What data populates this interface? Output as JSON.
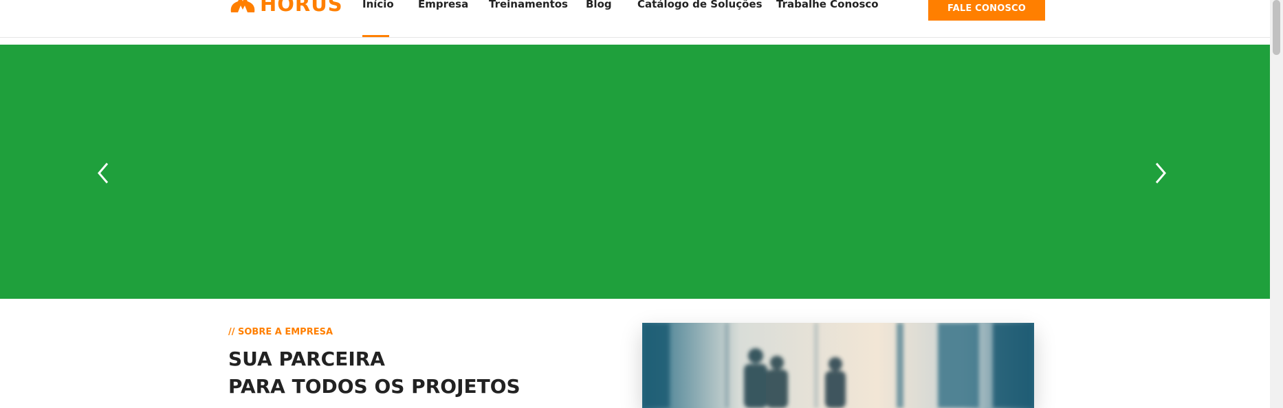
{
  "header": {
    "logo_text": "HORUS",
    "nav": [
      {
        "label": "Início",
        "active": true
      },
      {
        "label": "Empresa"
      },
      {
        "label": "Treinamentos"
      },
      {
        "label": "Blog"
      },
      {
        "label": "Catálogo de Soluções"
      },
      {
        "label": "Trabalhe Conosco"
      }
    ],
    "cta_label": "FALE CONOSCO"
  },
  "hero": {
    "background_color": "#1fa03c",
    "prev_icon": "chevron-left-icon",
    "next_icon": "chevron-right-icon"
  },
  "about": {
    "eyebrow": "// SOBRE A EMPRESA",
    "title_line1": "SUA PARCEIRA",
    "title_line2": "PARA TODOS OS PROJETOS"
  },
  "colors": {
    "accent": "#ff7f00",
    "text": "#222222"
  }
}
